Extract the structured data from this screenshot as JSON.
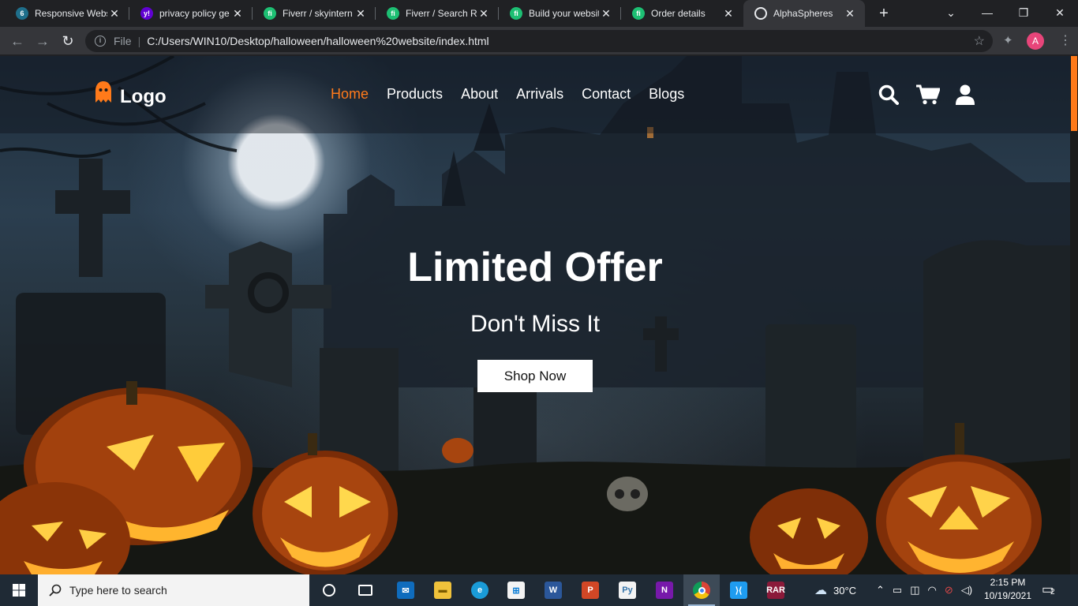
{
  "browser": {
    "tabs": [
      {
        "title": "Responsive Webs",
        "favicon_color": "#1f6f8b",
        "favicon_glyph": "6"
      },
      {
        "title": "privacy policy ge",
        "favicon_color": "#6001d2",
        "favicon_glyph": "y!"
      },
      {
        "title": "Fiverr / skyintern",
        "favicon_color": "#1dbf73",
        "favicon_glyph": "fi"
      },
      {
        "title": "Fiverr / Search Re",
        "favicon_color": "#1dbf73",
        "favicon_glyph": "fi"
      },
      {
        "title": "Build your websit",
        "favicon_color": "#1dbf73",
        "favicon_glyph": "fi"
      },
      {
        "title": "Order details",
        "favicon_color": "#1dbf73",
        "favicon_glyph": "fi"
      },
      {
        "title": "AlphaSpheres",
        "favicon_color": "#e8eaed",
        "favicon_glyph": "globe",
        "active": true
      }
    ],
    "address": {
      "scheme": "File",
      "url": "C:/Users/WIN10/Desktop/halloween/halloween%20website/index.html"
    },
    "profile_initial": "A"
  },
  "site": {
    "logo_text": "Logo",
    "accent_color": "#ff7a1a",
    "nav": [
      {
        "label": "Home",
        "active": true
      },
      {
        "label": "Products"
      },
      {
        "label": "About"
      },
      {
        "label": "Arrivals"
      },
      {
        "label": "Contact"
      },
      {
        "label": "Blogs"
      }
    ],
    "header_icons": [
      "search-icon",
      "cart-icon",
      "user-icon"
    ],
    "hero": {
      "title": "Limited Offer",
      "subtitle": "Don't Miss It",
      "cta": "Shop Now"
    }
  },
  "taskbar": {
    "search_placeholder": "Type here to search",
    "apps": [
      "task-view",
      "mail",
      "file-explorer",
      "edge",
      "store",
      "word",
      "powerpoint",
      "python",
      "onenote",
      "chrome",
      "vscode",
      "winrar"
    ],
    "weather": "30°C",
    "time": "2:15 PM",
    "date": "10/19/2021",
    "notification_count": "2"
  }
}
